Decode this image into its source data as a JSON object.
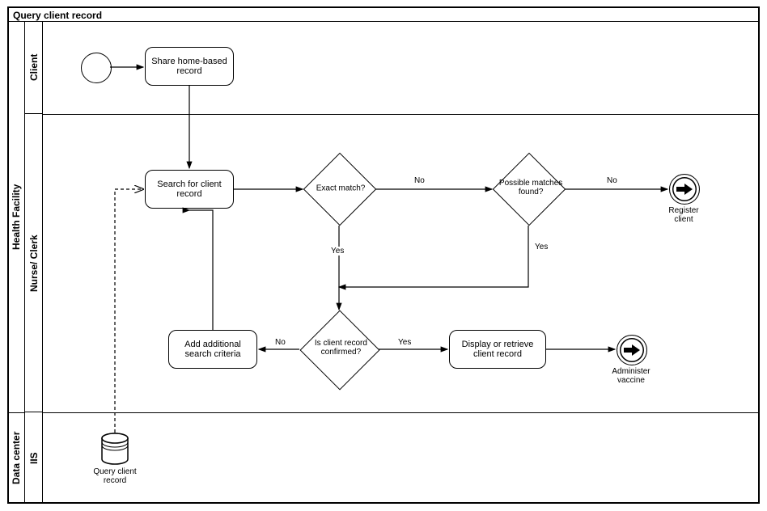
{
  "chart_data": {
    "type": "bpmn-workflow",
    "title": "Query  client record",
    "pool": "Health Facility",
    "lanes": [
      "Client",
      "Nurse/ Clerk",
      "IIS"
    ],
    "sublane_group": "Data center",
    "nodes": [
      {
        "id": "start",
        "type": "start-event",
        "lane": "Client"
      },
      {
        "id": "share",
        "type": "task",
        "lane": "Client",
        "label": "Share home-based record"
      },
      {
        "id": "search",
        "type": "task",
        "lane": "Nurse/ Clerk",
        "label": "Search for client record"
      },
      {
        "id": "exact",
        "type": "gateway",
        "lane": "Nurse/ Clerk",
        "label": "Exact match?"
      },
      {
        "id": "possible",
        "type": "gateway",
        "lane": "Nurse/ Clerk",
        "label": "Possible matches found?"
      },
      {
        "id": "register",
        "type": "end-event-link",
        "lane": "Nurse/ Clerk",
        "label": "Register client"
      },
      {
        "id": "confirmed",
        "type": "gateway",
        "lane": "Nurse/ Clerk",
        "label": "Is client record confirmed?"
      },
      {
        "id": "additional",
        "type": "task",
        "lane": "Nurse/ Clerk",
        "label": "Add additional search criteria"
      },
      {
        "id": "display",
        "type": "task",
        "lane": "Nurse/ Clerk",
        "label": "Display or retrieve client record"
      },
      {
        "id": "administer",
        "type": "end-event-link",
        "lane": "Nurse/ Clerk",
        "label": "Administer vaccine"
      },
      {
        "id": "datastore",
        "type": "data-store",
        "lane": "IIS",
        "label": "Query client record"
      }
    ],
    "edges": [
      {
        "from": "start",
        "to": "share"
      },
      {
        "from": "share",
        "to": "search"
      },
      {
        "from": "search",
        "to": "exact"
      },
      {
        "from": "exact",
        "to": "possible",
        "label": "No"
      },
      {
        "from": "possible",
        "to": "register",
        "label": "No"
      },
      {
        "from": "exact",
        "to": "confirmed",
        "label": "Yes"
      },
      {
        "from": "possible",
        "to": "confirmed",
        "label": "Yes"
      },
      {
        "from": "confirmed",
        "to": "additional",
        "label": "No"
      },
      {
        "from": "additional",
        "to": "search"
      },
      {
        "from": "confirmed",
        "to": "display",
        "label": "Yes"
      },
      {
        "from": "display",
        "to": "administer"
      },
      {
        "from": "datastore",
        "to": "search",
        "type": "data-association"
      }
    ]
  },
  "title": "Query  client record",
  "pool_label": "Health Facility",
  "datacenter_label": "Data center",
  "lanes": {
    "client": "Client",
    "nurse": "Nurse/ Clerk",
    "iis": "IIS"
  },
  "tasks": {
    "share": "Share home-based record",
    "search": "Search for client record",
    "additional": "Add additional search criteria",
    "display": "Display or retrieve client record"
  },
  "gateways": {
    "exact": "Exact match?",
    "possible": "Possible matches found?",
    "confirmed": "Is client record confirmed?"
  },
  "end_events": {
    "register": "Register client",
    "administer": "Administer vaccine"
  },
  "datastore": "Query client record",
  "edge_labels": {
    "no1": "No",
    "no2": "No",
    "no3": "No",
    "yes1": "Yes",
    "yes2": "Yes",
    "yes3": "Yes"
  }
}
